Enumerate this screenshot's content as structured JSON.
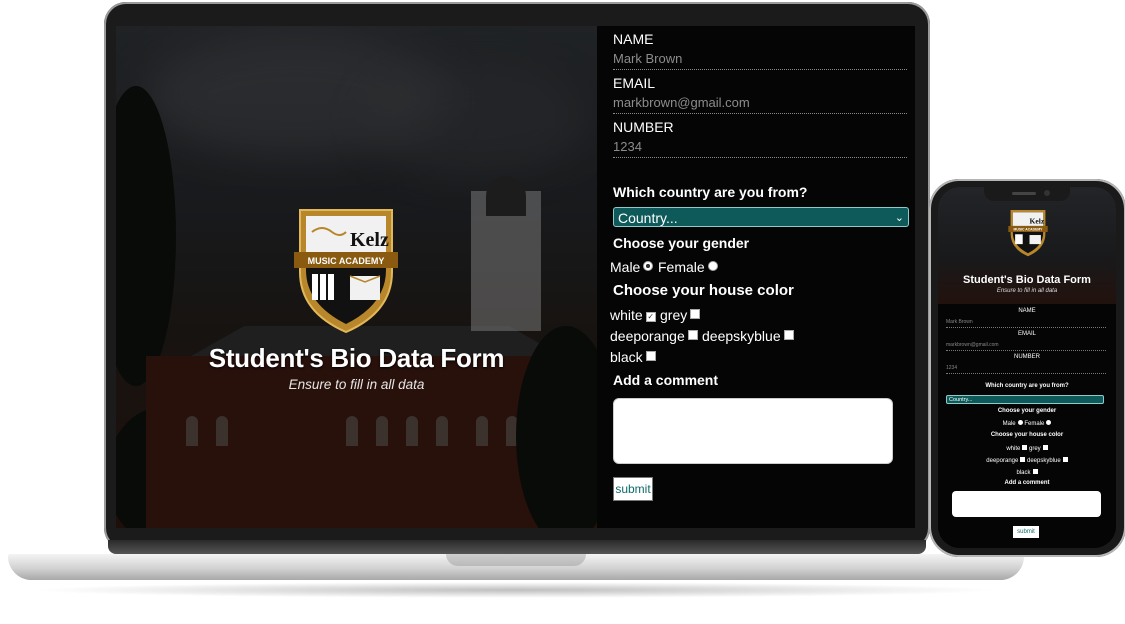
{
  "hero": {
    "title": "Student's Bio Data Form",
    "subtitle": "Ensure to fill in all data",
    "logo_text": "Kelz",
    "logo_banner": "MUSIC ACADEMY"
  },
  "form": {
    "name_label": "NAME",
    "name_value": "Mark Brown",
    "email_label": "EMAIL",
    "email_value": "markbrown@gmail.com",
    "number_label": "NUMBER",
    "number_value": "1234",
    "country_question": "Which country are you from?",
    "country_selected": "Country...",
    "gender_question": "Choose your gender",
    "gender_options": [
      "Male",
      "Female"
    ],
    "gender_selected": "Male",
    "house_question": "Choose your house color",
    "house_options": [
      "white",
      "grey",
      "deeporange",
      "deepskyblue",
      "black"
    ],
    "house_checked": [
      "white"
    ],
    "comment_question": "Add a comment",
    "submit_label": "submit"
  },
  "colors": {
    "select_bg": "#0e5a5a",
    "submit_text": "#0e6a6a",
    "form_bg": "#050505"
  }
}
